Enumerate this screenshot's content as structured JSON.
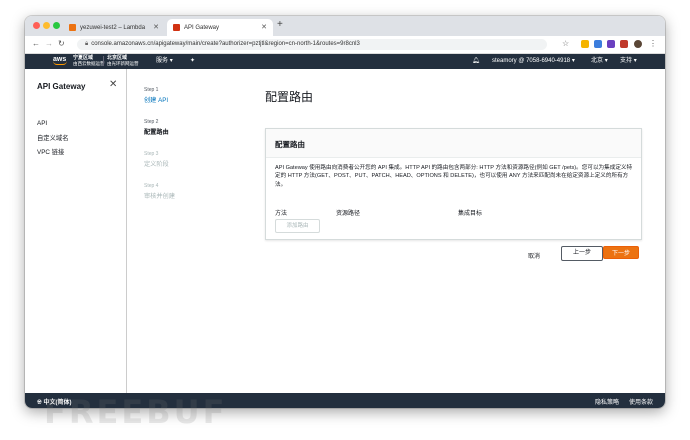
{
  "browser": {
    "tabs": [
      {
        "title": "yezuwei-test2 – Lambda"
      },
      {
        "title": "API Gateway"
      }
    ],
    "new_tab": "+",
    "url": "console.amazonaws.cn/apigateway/main/create?authorizer=pztjtl&region=cn-north-1&routes=9r8cnl3"
  },
  "aws_nav": {
    "logo": "aws",
    "region1_line1": "宁夏区域",
    "region1_line2": "由西云数据运营",
    "region2_line1": "北京区域",
    "region2_line2": "由光环新网运营",
    "services": "服务",
    "account": "steamory @ 7058-6940-4918",
    "region": "北京",
    "support": "支持"
  },
  "sidebar": {
    "title": "API Gateway",
    "items": [
      {
        "label": "API"
      },
      {
        "label": "自定义域名"
      },
      {
        "label": "VPC 链接"
      }
    ]
  },
  "steps": [
    {
      "num": "Step 1",
      "label": "创建 API"
    },
    {
      "num": "Step 2",
      "label": "配置路由"
    },
    {
      "num": "Step 3",
      "label": "定义阶段"
    },
    {
      "num": "Step 4",
      "label": "审核并创建"
    }
  ],
  "main": {
    "page_title": "配置路由",
    "card_title": "配置路由",
    "card_desc": "API Gateway 使用路由向消费者公开您的 API 集成。HTTP API 的路由包含两部分: HTTP 方法和资源路径(例如 GET /pets)。您可以为集成定义特定的 HTTP 方法(GET、POST、PUT、PATCH、HEAD、OPTIONS 和 DELETE)，也可以使用 ANY 方法来匹配尚未在给定资源上定义的所有方法。",
    "col_method": "方法",
    "col_path": "资源路径",
    "col_target": "集成目标",
    "add_route": "添加路由",
    "cancel": "取消",
    "prev": "上一步",
    "next": "下一步"
  },
  "footer": {
    "language": "中文(简体)",
    "privacy": "隐私策略",
    "terms": "使用条款"
  },
  "watermark": "FREEBUF",
  "colors": {
    "aws_nav": "#232f3e",
    "primary_button": "#ec7211",
    "link_blue": "#0073bb"
  }
}
